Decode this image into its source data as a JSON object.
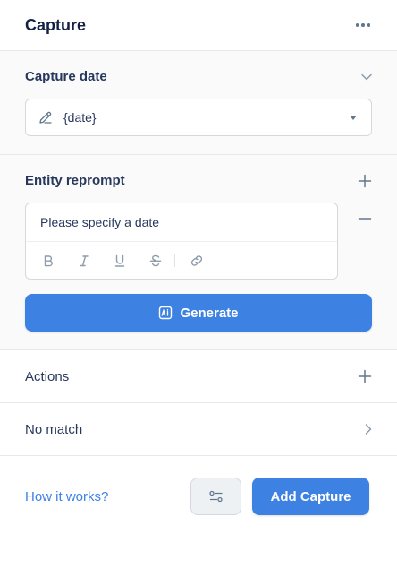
{
  "header": {
    "title": "Capture",
    "more_icon": "more-horizontal-icon"
  },
  "capture_date": {
    "label": "Capture date",
    "select_value": "{date}",
    "icon": "pencil-icon"
  },
  "reprompt": {
    "label": "Entity reprompt",
    "text": "Please specify a date",
    "toolbar": [
      "bold-icon",
      "italic-icon",
      "underline-icon",
      "strikethrough-icon",
      "link-icon"
    ]
  },
  "generate": {
    "label": "Generate",
    "icon": "ai-icon"
  },
  "actions": {
    "label": "Actions"
  },
  "no_match": {
    "label": "No match"
  },
  "footer": {
    "link": "How it works?",
    "settings_icon": "sliders-icon",
    "add_label": "Add Capture"
  },
  "colors": {
    "accent": "#3d82e2",
    "text": "#132144",
    "muted": "#8d9bab",
    "border": "#d4d9e0"
  }
}
